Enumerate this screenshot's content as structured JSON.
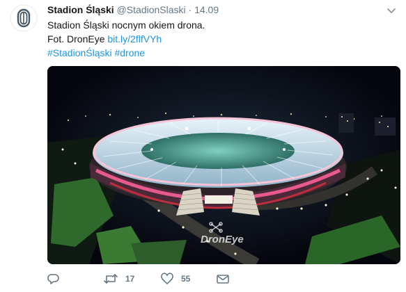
{
  "tweet": {
    "display_name": "Stadion Śląski",
    "handle": "@StadionSlaski",
    "separator": "·",
    "time": "14.09",
    "text_line1": "Stadion Śląski nocnym okiem drona.",
    "text_line2_prefix": "Fot. DronEye ",
    "text_line2_link": "bit.ly/2flfVYh",
    "hashtags": "#StadionŚląski #drone"
  },
  "media": {
    "watermark": "DronEye",
    "colors": {
      "sky": "#070912",
      "roof_light": "#cfe3f0",
      "stadium_ring_pink": "#e05a8a",
      "stadium_ring_red": "#d83040",
      "grass": "#2d6b2a"
    }
  },
  "actions": {
    "reply_icon": "reply-icon",
    "retweet_icon": "retweet-icon",
    "retweet_count": "17",
    "like_icon": "heart-icon",
    "like_count": "55",
    "dm_icon": "envelope-icon"
  },
  "colors": {
    "link": "#1b95e0",
    "muted": "#657786",
    "text": "#14171a"
  }
}
